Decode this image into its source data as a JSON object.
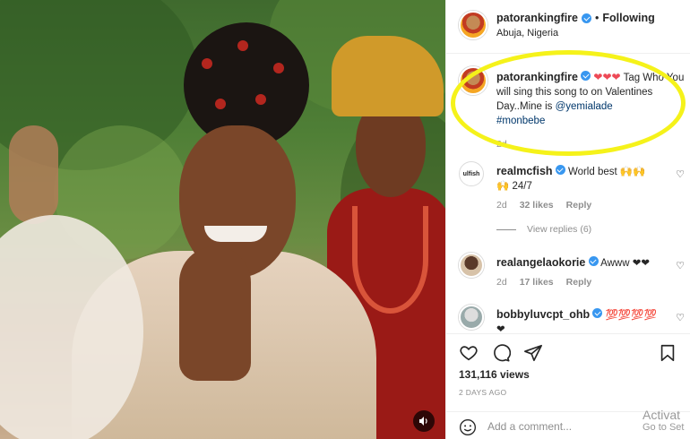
{
  "post": {
    "username": "patorankingfire",
    "separator": "•",
    "follow_status": "Following",
    "location": "Abuja, Nigeria",
    "caption_hearts": "❤❤❤",
    "caption_text": " Tag Who You will sing this song to on Valentines Day..Mine is ",
    "caption_mention": "@yemialade",
    "caption_hashtag": "#monbebe",
    "caption_age": "2d"
  },
  "comments": [
    {
      "avatar_text": "ulfish",
      "username": "realmcfish",
      "text": "World best 🙌🙌 🙌 24/7",
      "age": "2d",
      "likes": "32 likes",
      "reply": "Reply",
      "view_replies": "View replies (6)"
    },
    {
      "username": "realangelaokorie",
      "text": "Awww ❤❤",
      "age": "2d",
      "likes": "17 likes",
      "reply": "Reply"
    },
    {
      "username": "bobbyluvcpt_ohb",
      "text": "💯💯💯💯 ❤"
    }
  ],
  "footer": {
    "views": "131,116 views",
    "date": "2 DAYS AGO",
    "add_comment_placeholder": "Add a comment...",
    "watermark_line1": "Activat",
    "watermark_line2": "Go to Set"
  },
  "colors": {
    "verified": "#3897f0",
    "heart": "#ed4956",
    "highlight": "#f5f21a",
    "link": "#00376b"
  }
}
